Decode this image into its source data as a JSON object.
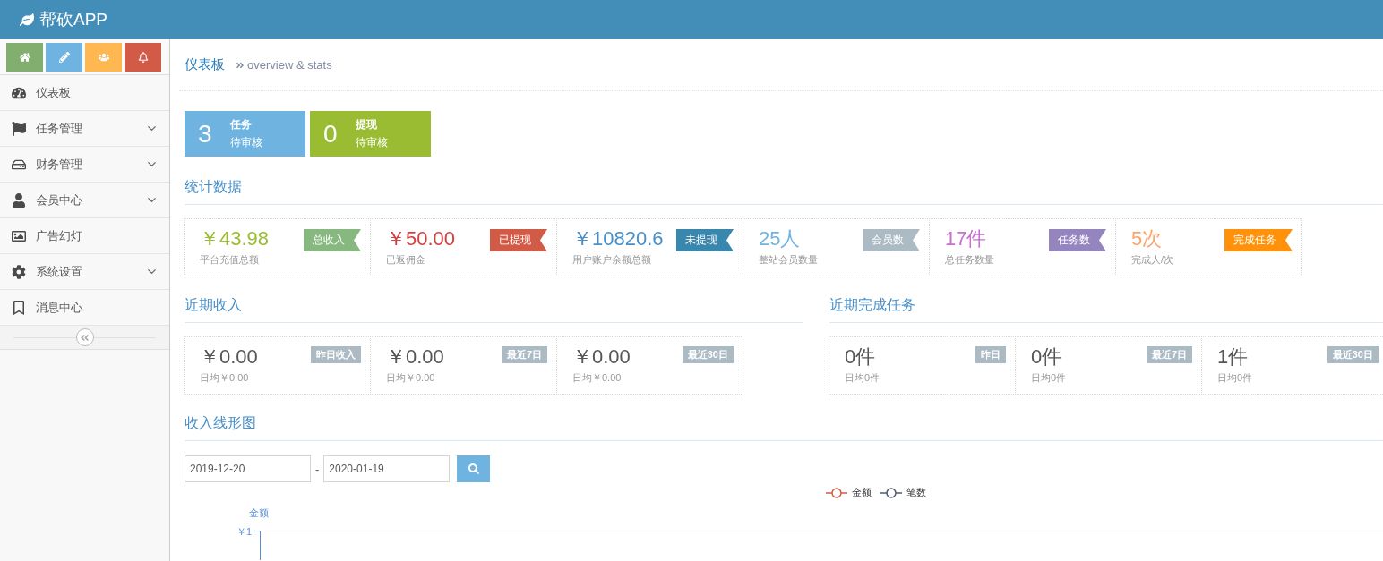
{
  "app": {
    "title": "帮砍APP"
  },
  "shortcuts": [
    {
      "kind": "home"
    },
    {
      "kind": "edit"
    },
    {
      "kind": "users"
    },
    {
      "kind": "bell"
    }
  ],
  "sidebar": {
    "items": [
      {
        "label": "仪表板",
        "expandable": false
      },
      {
        "label": "任务管理",
        "expandable": true
      },
      {
        "label": "财务管理",
        "expandable": true
      },
      {
        "label": "会员中心",
        "expandable": true
      },
      {
        "label": "广告幻灯",
        "expandable": false
      },
      {
        "label": "系统设置",
        "expandable": true
      },
      {
        "label": "消息中心",
        "expandable": false
      }
    ]
  },
  "page": {
    "title": "仪表板",
    "subtitle": "overview & stats"
  },
  "pending": [
    {
      "count": "3",
      "title": "任务",
      "status": "待审核",
      "color": "#6fb3e0"
    },
    {
      "count": "0",
      "title": "提现",
      "status": "待审核",
      "color": "#9abc32"
    }
  ],
  "stats": {
    "heading": "统计数据",
    "cards": [
      {
        "value": "￥43.98",
        "caption": "平台充值总额",
        "badge": "总收入",
        "color": "#87b87f"
      },
      {
        "value": "￥50.00",
        "caption": "已返佣金",
        "badge": "已提现",
        "color": "#d15b47"
      },
      {
        "value": "￥10820.6",
        "caption": "用户账户余额总额",
        "badge": "未提现",
        "color": "#3a87ad"
      },
      {
        "value": "25人",
        "caption": "整站会员数量",
        "badge": "会员数",
        "color": "#abbac3"
      },
      {
        "value": "17件",
        "caption": "总任务数量",
        "badge": "任务数",
        "color": "#9585bf"
      },
      {
        "value": "5次",
        "caption": "完成人/次",
        "badge": "完成任务",
        "color": "#ff920a"
      }
    ]
  },
  "recent_income": {
    "heading": "近期收入",
    "cards": [
      {
        "value": "￥0.00",
        "badge": "昨日收入",
        "caption": "日均￥0.00"
      },
      {
        "value": "￥0.00",
        "badge": "最近7日",
        "caption": "日均￥0.00"
      },
      {
        "value": "￥0.00",
        "badge": "最近30日",
        "caption": "日均￥0.00"
      }
    ]
  },
  "recent_tasks": {
    "heading": "近期完成任务",
    "cards": [
      {
        "value": "0件",
        "badge": "昨日",
        "caption": "日均0件"
      },
      {
        "value": "0件",
        "badge": "最近7日",
        "caption": "日均0件"
      },
      {
        "value": "1件",
        "badge": "最近30日",
        "caption": "日均0件"
      }
    ]
  },
  "chart": {
    "heading": "收入线形图",
    "date_from": "2019-12-20",
    "separator": "-",
    "date_to": "2020-01-19",
    "legend": [
      {
        "label": "金额",
        "color": "#d15b47"
      },
      {
        "label": "笔数",
        "color": "#4e5b6a"
      }
    ],
    "y_axis_label": "金额",
    "y_tick": "￥1"
  }
}
